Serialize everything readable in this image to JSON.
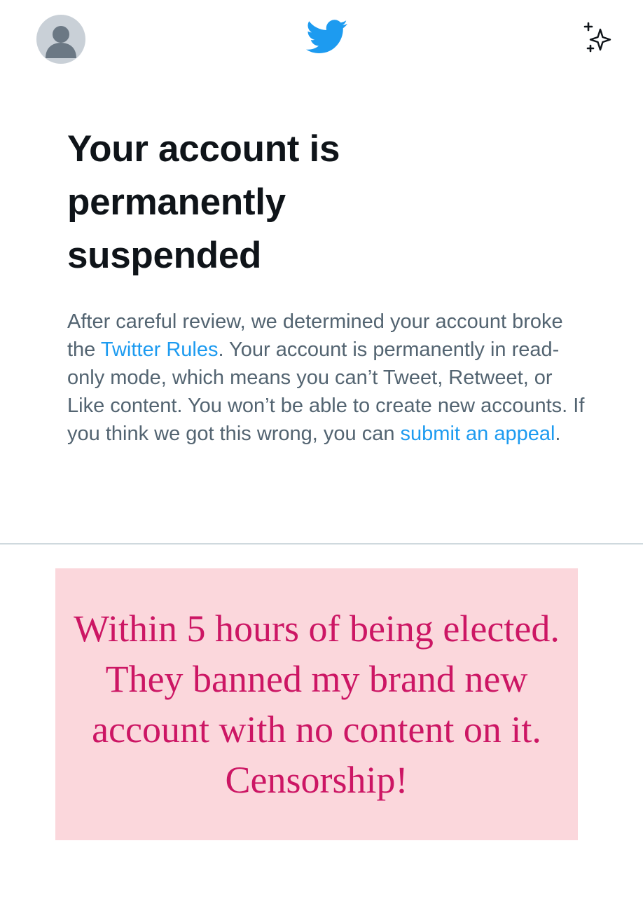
{
  "header": {
    "avatar_icon": "default-avatar-icon",
    "logo_icon": "twitter-bird-icon",
    "sparkle_icon": "sparkle-icon"
  },
  "notice": {
    "title": "Your account is permanently suspended",
    "body_part1": "After careful review, we determined your account broke the ",
    "rules_link": "Twitter Rules",
    "body_part2": ". Your account is permanently in read-only mode, which means you can’t Tweet, Retweet, or Like content. You won’t be able to create new accounts. If you think we got this wrong, you can ",
    "appeal_link": "submit an appeal",
    "body_part3": "."
  },
  "caption": {
    "text": "Within 5 hours of being elected. They banned my brand new account with no content on it. Censorship!"
  },
  "colors": {
    "title": "#0f1419",
    "body": "#536471",
    "link": "#1d9bf0",
    "twitter_blue": "#1d9bf0",
    "caption_bg": "#fbd7dc",
    "caption_text": "#cc1664"
  }
}
